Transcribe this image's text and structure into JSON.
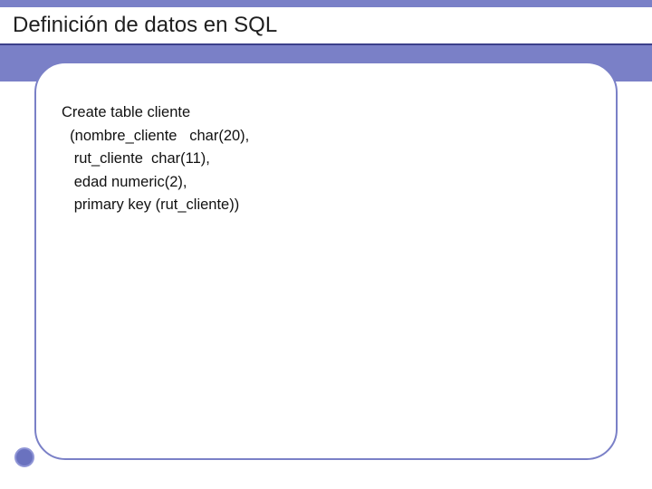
{
  "slide": {
    "title": "Definición de datos en SQL",
    "code_lines": [
      "Create table cliente",
      "  (nombre_cliente   char(20),",
      "   rut_cliente  char(11),",
      "   edad numeric(2),",
      "   primary key (rut_cliente))"
    ],
    "code_joined": "Create table cliente\n  (nombre_cliente   char(20),\n   rut_cliente  char(11),\n   edad numeric(2),\n   primary key (rut_cliente))"
  },
  "theme": {
    "accent": "#7a80c7",
    "underline": "#3b3f8a"
  }
}
